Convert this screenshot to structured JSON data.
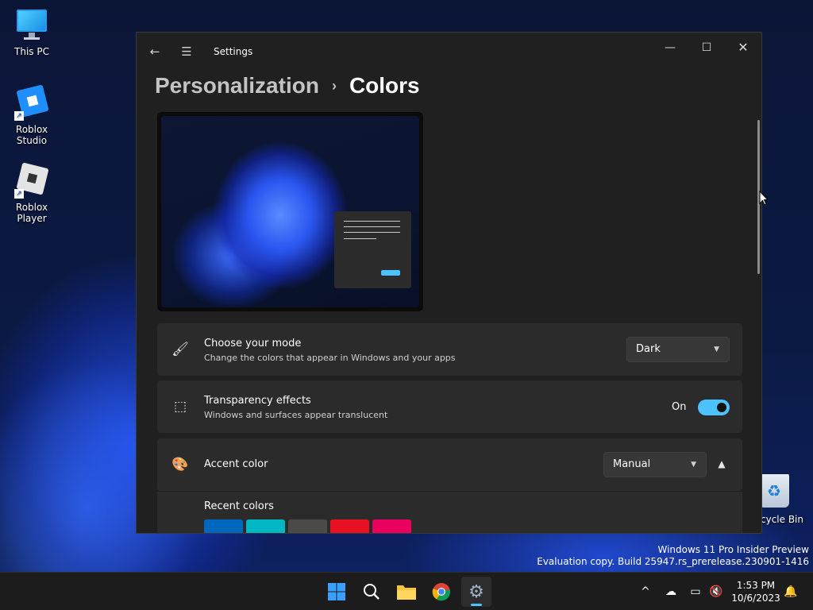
{
  "desktop": {
    "icons": [
      {
        "label": "This PC",
        "icon": "monitor-icon"
      },
      {
        "label": "Roblox Studio",
        "icon": "roblox-studio-icon"
      },
      {
        "label": "Roblox Player",
        "icon": "roblox-player-icon"
      }
    ],
    "recycle_bin": {
      "label": "cycle Bin",
      "icon": "recycle-bin-icon"
    },
    "watermark": {
      "line1": "Windows 11 Pro Insider Preview",
      "line2": "Evaluation copy. Build 25947.rs_prerelease.230901-1416"
    }
  },
  "window": {
    "title": "Settings",
    "breadcrumb": {
      "parent": "Personalization",
      "current": "Colors"
    },
    "mode": {
      "title": "Choose your mode",
      "subtitle": "Change the colors that appear in Windows and your apps",
      "value": "Dark"
    },
    "transparency": {
      "title": "Transparency effects",
      "subtitle": "Windows and surfaces appear translucent",
      "state_label": "On",
      "enabled": true
    },
    "accent": {
      "title": "Accent color",
      "value": "Manual",
      "recent_label": "Recent colors",
      "recent_colors": [
        "#0067c0",
        "#00b7c3",
        "#4c4a48",
        "#e81123",
        "#ea005e"
      ]
    },
    "accent_color": "#4cc2ff"
  },
  "taskbar": {
    "time": "1:53 PM",
    "date": "10/6/2023"
  }
}
